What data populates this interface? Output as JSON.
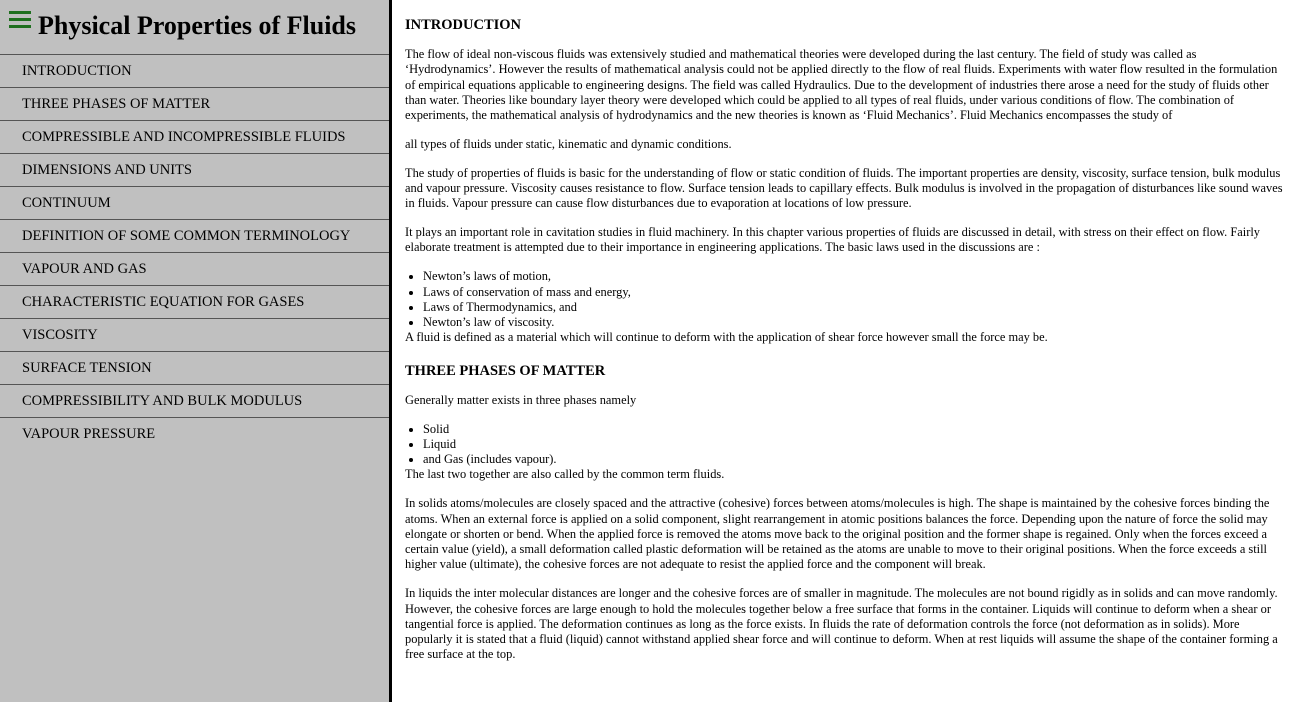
{
  "sidebar": {
    "title": "Physical Properties of Fluids",
    "items": [
      {
        "label": "INTRODUCTION"
      },
      {
        "label": "THREE PHASES OF MATTER"
      },
      {
        "label": "COMPRESSIBLE AND INCOMPRESSIBLE FLUIDS"
      },
      {
        "label": "DIMENSIONS AND UNITS"
      },
      {
        "label": "CONTINUUM"
      },
      {
        "label": "DEFINITION OF SOME COMMON TERMINOLOGY"
      },
      {
        "label": "VAPOUR AND GAS"
      },
      {
        "label": "CHARACTERISTIC EQUATION FOR GASES"
      },
      {
        "label": "VISCOSITY"
      },
      {
        "label": "SURFACE TENSION"
      },
      {
        "label": "COMPRESSIBILITY AND BULK MODULUS"
      },
      {
        "label": "VAPOUR PRESSURE"
      }
    ]
  },
  "colors": {
    "sidebar_bg": "#c0c0c0",
    "menu_icon": "#1f6f1f"
  },
  "icons": {
    "menu": "hamburger-menu-icon"
  },
  "content": {
    "intro": {
      "heading": "INTRODUCTION",
      "p1": "The flow of ideal non-viscous fluids was extensively studied and mathematical theories were developed during the last century. The field of study was called as ‘Hydrodynamics’. However the results of mathematical analysis could not be applied directly to the flow of real fluids. Experiments with water flow resulted in the formulation of empirical equations applicable to engineering designs. The field was called Hydraulics. Due to the development of industries there arose a need for the study of fluids other than water. Theories like boundary layer theory were developed which could be applied to all types of real fluids, under various conditions of flow. The combination of experiments, the mathematical analysis of hydrodynamics and the new theories is known as ‘Fluid Mechanics’. Fluid Mechanics encompasses the study of",
      "p2": "all types of fluids under static, kinematic and dynamic conditions.",
      "p3": "The study of properties of fluids is basic for the understanding of flow or static condition of fluids. The important properties are density, viscosity, surface tension, bulk modulus and vapour pressure. Viscosity causes resistance to flow. Surface tension leads to capillary effects. Bulk modulus is involved in the propagation of disturbances like sound waves in fluids. Vapour pressure can cause flow disturbances due to evaporation at locations of low pressure.",
      "p4": "It plays an important role in cavitation studies in fluid machinery. In this chapter various properties of fluids are discussed in detail, with stress on their effect on flow. Fairly elaborate treatment is attempted due to their importance in engineering applications. The basic laws used in the discussions are :",
      "laws": [
        "Newton’s laws of motion,",
        "Laws of conservation of mass and energy,",
        "Laws of Thermodynamics, and",
        "Newton’s law of viscosity."
      ],
      "p5": "A fluid is defined as a material which will continue to deform with the application of shear force however small the force may be."
    },
    "phases": {
      "heading": "THREE PHASES OF MATTER",
      "p1": "Generally matter exists in three phases namely",
      "items": [
        "Solid",
        "Liquid",
        "and Gas (includes vapour)."
      ],
      "p2": "The last two together are also called by the common term fluids.",
      "p3": "In solids atoms/molecules are closely spaced and the attractive (cohesive) forces between atoms/molecules is high. The shape is maintained by the cohesive forces binding the atoms. When an external force is applied on a solid component, slight rearrangement in atomic positions balances the force. Depending upon the nature of force the solid may elongate or shorten or bend. When the applied force is removed the atoms move back to the original position and the former shape is regained. Only when the forces exceed a certain value (yield), a small deformation called plastic deformation will be retained as the atoms are unable to move to their original positions. When the force exceeds a still higher value (ultimate), the cohesive forces are not adequate to resist the applied force and the component will break.",
      "p4": "In liquids the inter molecular distances are longer and the cohesive forces are of smaller in magnitude. The molecules are not bound rigidly as in solids and can move randomly. However, the cohesive forces are large enough to hold the molecules together below a free surface that forms in the container. Liquids will continue to deform when a shear or tangential force is applied. The deformation continues as long as the force exists. In fluids the rate of deformation controls the force (not deformation as in solids). More popularly it is stated that a fluid (liquid) cannot withstand applied shear force and will continue to deform. When at rest liquids will assume the shape of the container forming a free surface at the top."
    }
  }
}
